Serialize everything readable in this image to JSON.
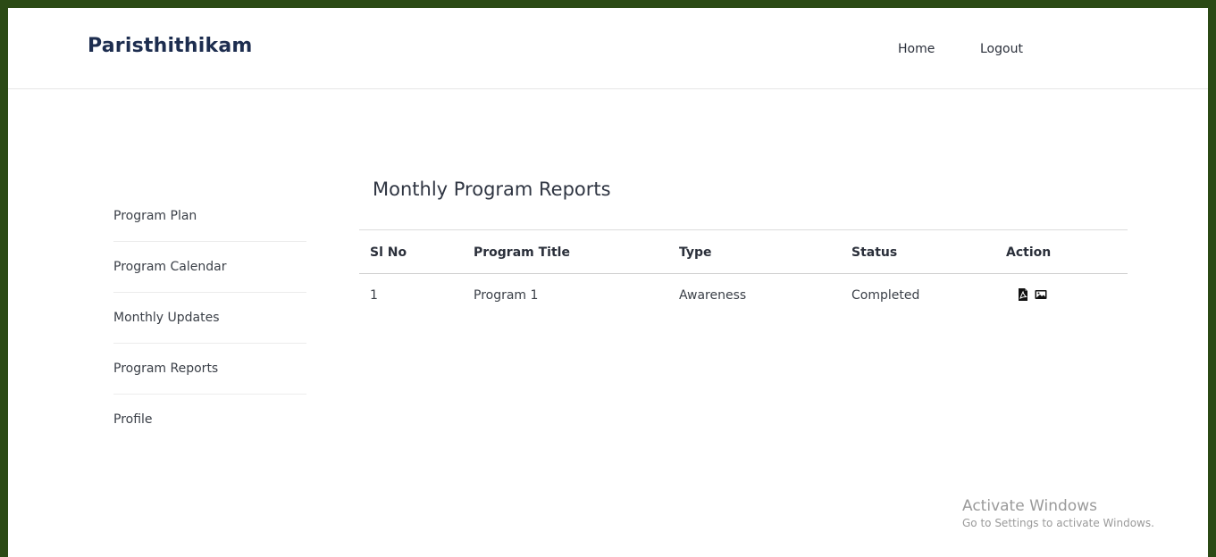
{
  "app": {
    "brand": "Paristhithikam"
  },
  "nav": {
    "home": "Home",
    "logout": "Logout"
  },
  "sidebar": {
    "items": [
      {
        "label": "Program Plan"
      },
      {
        "label": "Program Calendar"
      },
      {
        "label": "Monthly Updates"
      },
      {
        "label": "Program Reports"
      },
      {
        "label": "Profile"
      }
    ]
  },
  "main": {
    "title": "Monthly Program Reports",
    "table": {
      "headers": [
        "Sl No",
        "Program Title",
        "Type",
        "Status",
        "Action"
      ],
      "rows": [
        {
          "sl": "1",
          "title": "Program 1",
          "type": "Awareness",
          "status": "Completed",
          "actions": [
            "pdf-icon",
            "image-icon"
          ]
        }
      ]
    }
  },
  "watermark": {
    "title": "Activate Windows",
    "subtitle": "Go to Settings to activate Windows."
  },
  "colors": {
    "frame": "#2b4a15",
    "brand": "#1d2d4f"
  }
}
